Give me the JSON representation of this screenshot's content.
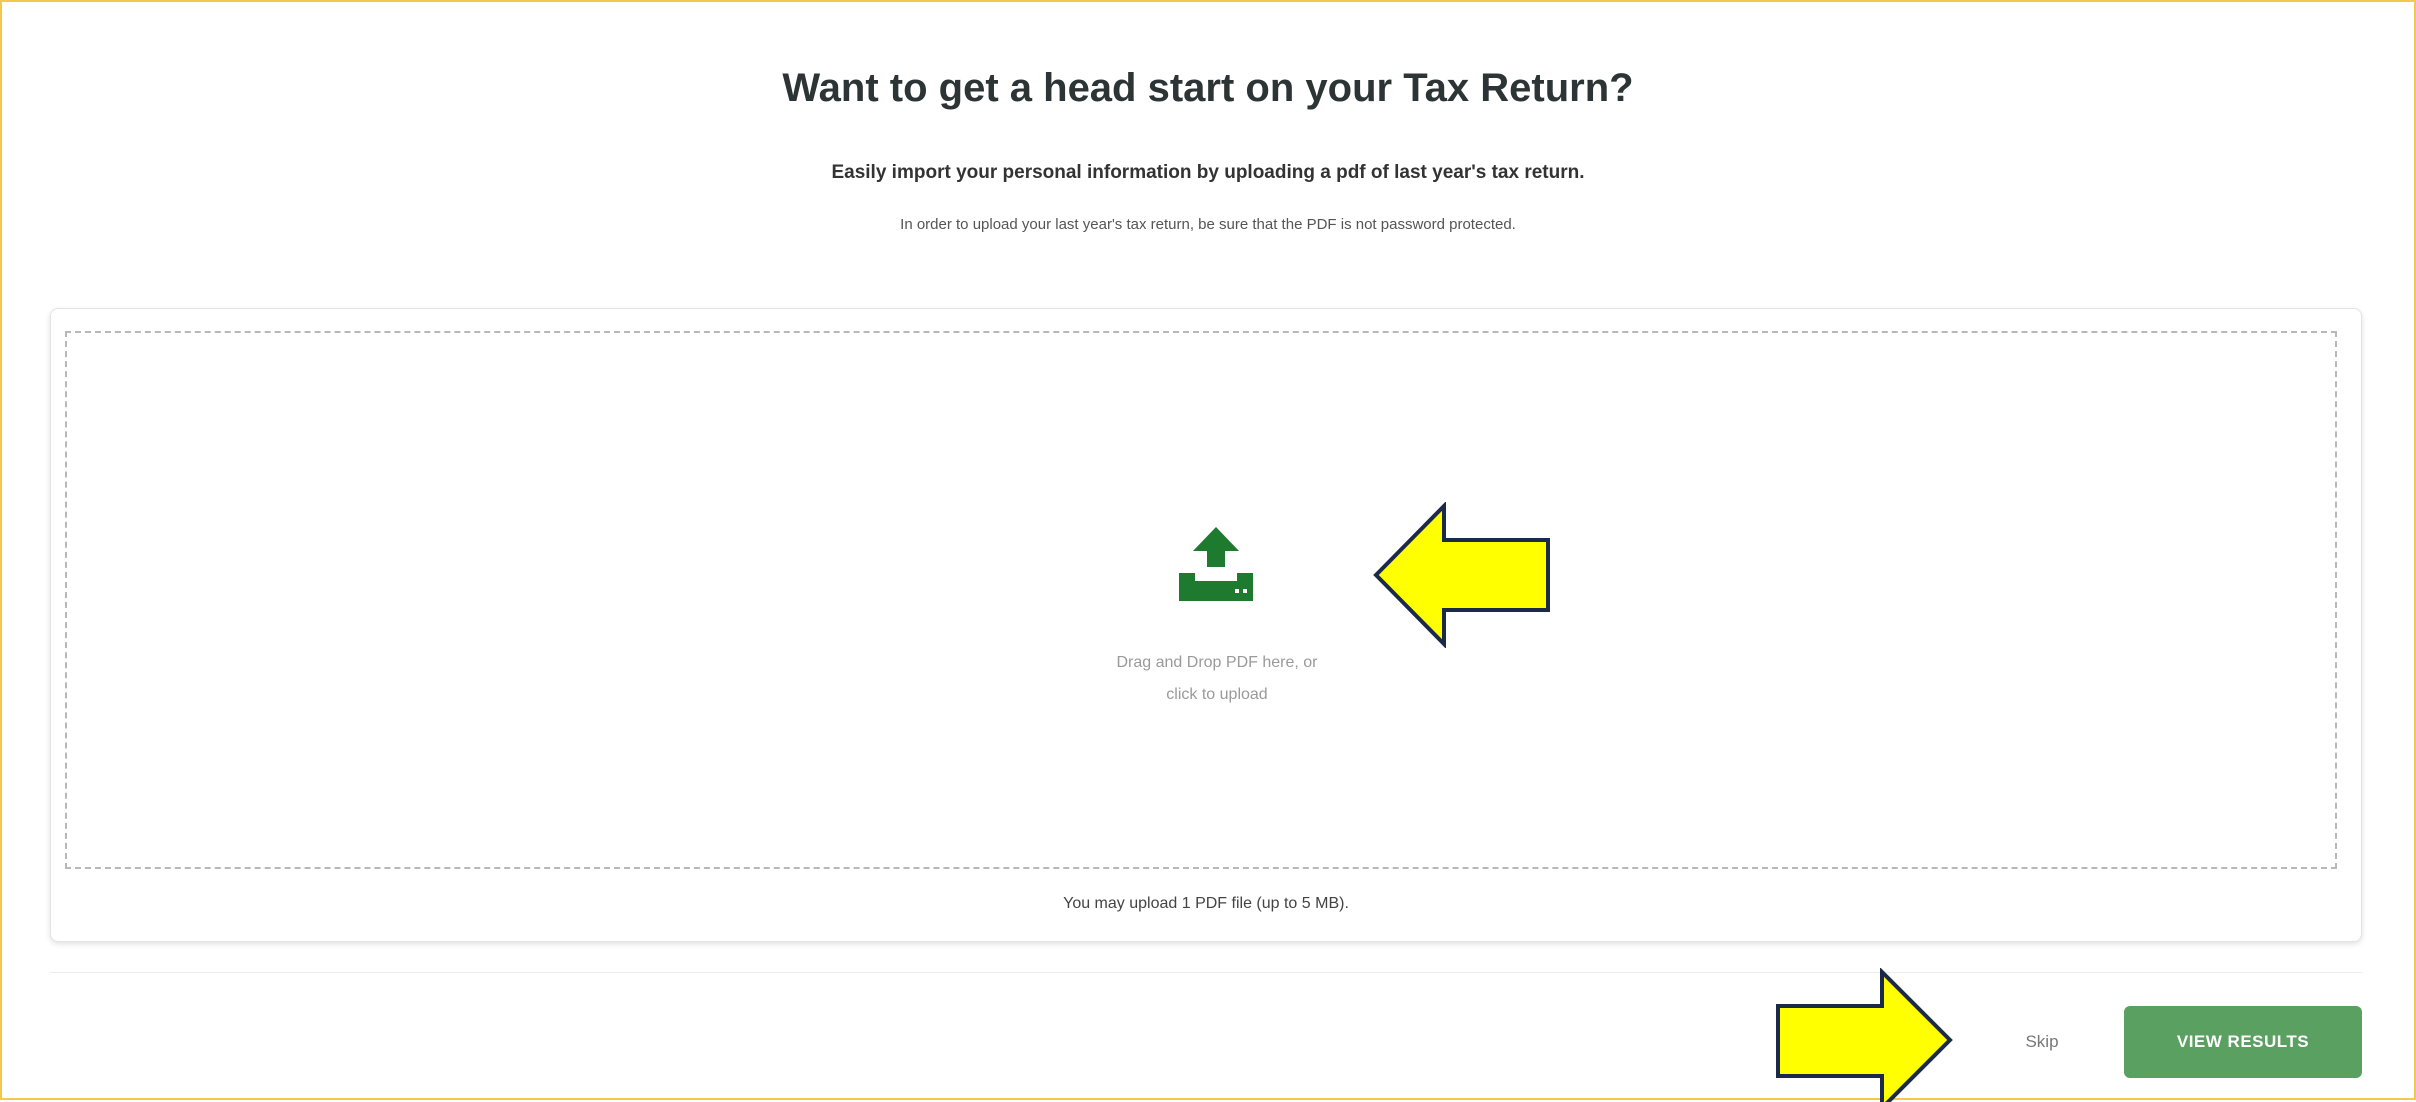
{
  "header": {
    "title": "Want to get a head start on your Tax Return?",
    "subtitle": "Easily import your personal information by uploading a pdf of last year's tax return.",
    "note": "In order to upload your last year's tax return, be sure that the PDF is not password protected."
  },
  "upload": {
    "icon": "upload-icon",
    "prompt_line1": "Drag and Drop PDF here, or",
    "prompt_line2": "click to upload",
    "limit_note": "You may upload 1 PDF file (up to 5 MB)."
  },
  "footer": {
    "skip_label": "Skip",
    "view_results_label": "VIEW RESULTS"
  },
  "colors": {
    "accent_green": "#5aa061",
    "icon_green": "#1e7a2e",
    "annotation_arrow": "#ffff00",
    "frame_border": "#f2c94c"
  }
}
